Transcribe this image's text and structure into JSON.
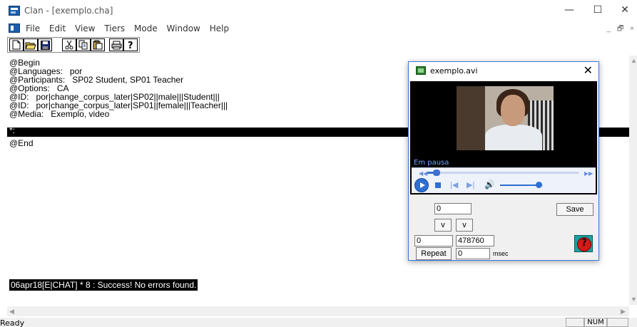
{
  "window": {
    "title": "Clan - [exemplo.cha]",
    "minimize": "—",
    "maximize": "☐",
    "close": "✕"
  },
  "menu": {
    "items": [
      "File",
      "Edit",
      "View",
      "Tiers",
      "Mode",
      "Window",
      "Help"
    ],
    "mdi_minimize": "_",
    "mdi_restore": "🗗",
    "mdi_close": "×"
  },
  "toolbar": {
    "buttons": [
      "new-icon",
      "open-icon",
      "save-icon",
      "cut-icon",
      "copy-icon",
      "paste-icon",
      "print-icon",
      "help-icon"
    ]
  },
  "document": {
    "lines": [
      "@Begin",
      "@Languages:\tpor",
      "@Participants:\tSP02 Student, SP01 Teacher",
      "@Options:\tCA",
      "@ID:\tpor|change_corpus_later|SP02||male|||Student|||",
      "@ID:\tpor|change_corpus_later|SP01||female|||Teacher|||",
      "@Media:\tExemplo, video",
      "*:",
      "@End"
    ],
    "status_message": "06apr18[E|CHAT] * 8 : Success! No errors found."
  },
  "statusbar": {
    "ready": "Ready",
    "num": "NUM"
  },
  "media_window": {
    "title": "exemplo.avi",
    "close": "✕",
    "pause_status": "Em pausa",
    "seek_progress": 0.06,
    "volume_level": 0.9,
    "top_value": "0",
    "save_label": "Save",
    "v_left": "v",
    "v_right": "v",
    "start_value": "0",
    "end_value": "478760",
    "repeat_label": "Repeat",
    "repeat_value": "0",
    "msec_label": "msec"
  }
}
